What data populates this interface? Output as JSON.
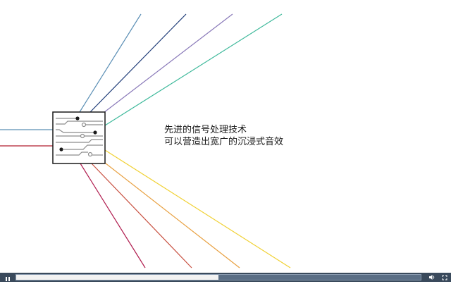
{
  "caption": {
    "line1": "先进的信号处理技术",
    "line2": "可以营造出宽广的沉浸式音效"
  },
  "player": {
    "progress_fraction": 0.5,
    "icons": {
      "pause": "pause-icon",
      "volume": "volume-icon",
      "fullscreen": "fullscreen-icon"
    }
  },
  "colors": {
    "chip_border": "#1a1a1a",
    "input_blue": "#5b8fb5",
    "input_red": "#b01c2e",
    "line_steel_blue": "#5b8fb5",
    "line_navy": "#1f3c78",
    "line_purple": "#8878b8",
    "line_teal": "#3cb89a",
    "line_yellow": "#f0d030",
    "line_orange": "#e8a040",
    "line_red": "#c85040",
    "line_crimson": "#b01c4e",
    "control_bar": "#3a4a5c"
  }
}
